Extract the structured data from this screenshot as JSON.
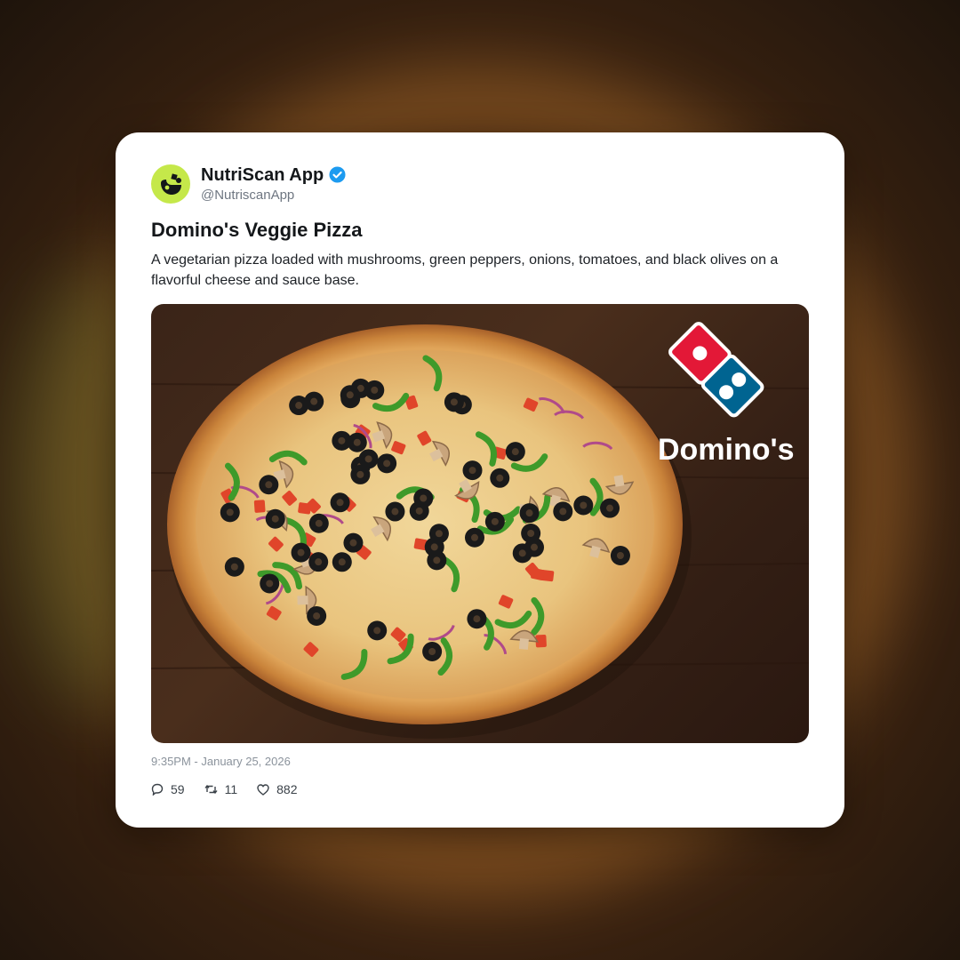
{
  "post": {
    "display_name": "NutriScan App",
    "handle": "@NutriscanApp",
    "verified": true,
    "title": "Domino's Veggie Pizza",
    "description": "A vegetarian pizza loaded with mushrooms, green peppers, onions, tomatoes, and black olives on a flavorful cheese and sauce base.",
    "timestamp": "9:35PM - January 25, 2026",
    "image": {
      "subject": "veggie pizza on wooden table",
      "logo_text": "Domino's",
      "logo_colors": {
        "red": "#e31837",
        "blue": "#006491"
      }
    },
    "stats": {
      "replies": "59",
      "reposts": "11",
      "likes": "882"
    }
  },
  "icons": {
    "avatar": "nutriscan-logo-icon",
    "verified": "verified-badge-icon",
    "reply": "reply-icon",
    "repost": "repost-icon",
    "like": "heart-icon"
  },
  "colors": {
    "avatar_bg": "#c5e84a",
    "verified": "#1d9bf0"
  }
}
